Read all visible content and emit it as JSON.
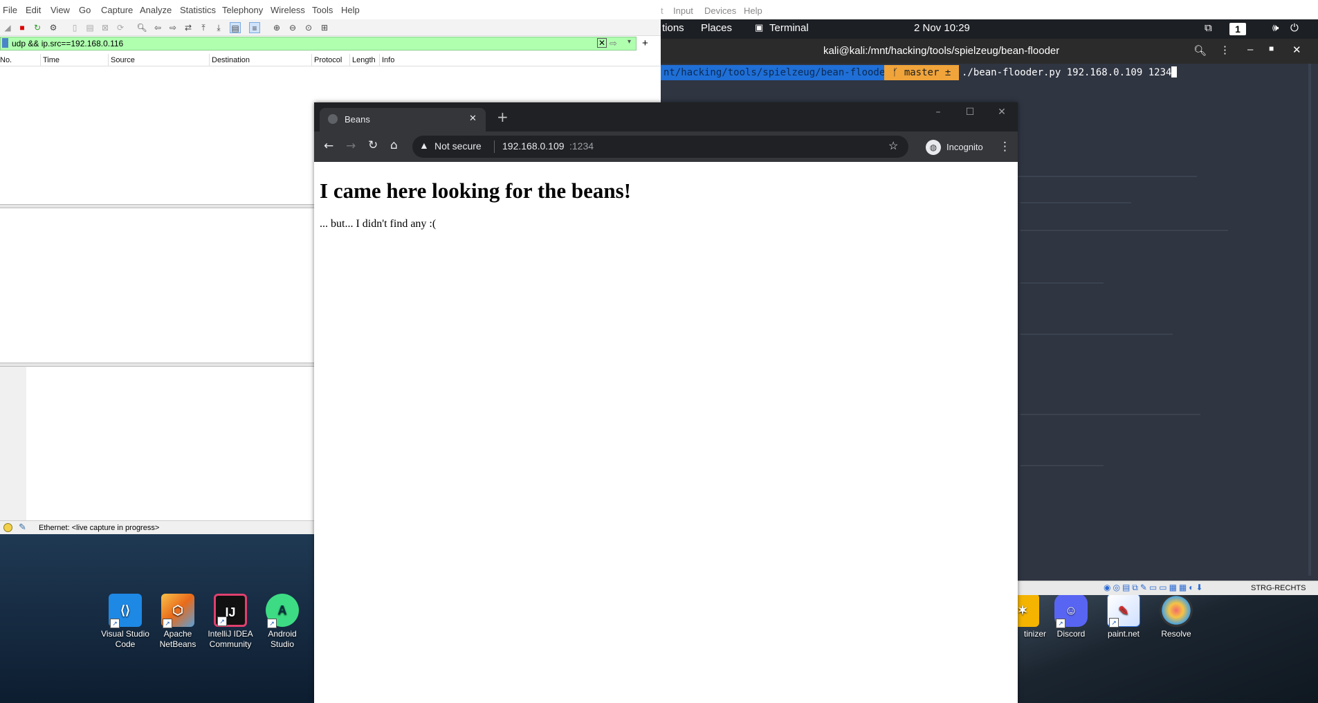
{
  "wireshark": {
    "menu": [
      "File",
      "Edit",
      "View",
      "Go",
      "Capture",
      "Analyze",
      "Statistics",
      "Telephony",
      "Wireless",
      "Tools",
      "Help"
    ],
    "filter_value": "udp && ip.src==192.168.0.116",
    "columns": [
      "No.",
      "Time",
      "Source",
      "Destination",
      "Protocol",
      "Length",
      "Info"
    ],
    "status_text": "Ethernet: <live capture in progress>",
    "filter_color": "#afffaf"
  },
  "desktop_icons": [
    {
      "label_line1": "Visual Studio",
      "label_line2": "Code",
      "icon": "vscode-icon",
      "color": "#1e88e5"
    },
    {
      "label_line1": "Apache",
      "label_line2": "NetBeans",
      "icon": "netbeans-icon",
      "color": "#ef6c00"
    },
    {
      "label_line1": "IntelliJ IDEA",
      "label_line2": "Community",
      "icon": "intellij-icon",
      "color": "#111111"
    },
    {
      "label_line1": "Android",
      "label_line2": "Studio",
      "icon": "android-studio-icon",
      "color": "#3ddc84"
    },
    {
      "label_line1": "tinizer",
      "label_line2": "",
      "icon": "app-icon",
      "color": "#f4b400"
    },
    {
      "label_line1": "Discord",
      "label_line2": "",
      "icon": "discord-icon",
      "color": "#5865f2"
    },
    {
      "label_line1": "paint.net",
      "label_line2": "",
      "icon": "paintnet-icon",
      "color": "#2a6ad4"
    },
    {
      "label_line1": "Resolve",
      "label_line2": "",
      "icon": "resolve-icon",
      "color": "#4aa3df"
    }
  ],
  "vm": {
    "menu": [
      "Input",
      "Devices",
      "Help"
    ],
    "status_key": "STRG-RECHTS"
  },
  "kali": {
    "topbar": {
      "applications_partial": "tions",
      "places": "Places",
      "terminal": "Terminal",
      "clock": "2 Nov  10:29",
      "workspace": "1"
    },
    "terminal_title": "kali@kali:/mnt/hacking/tools/spielzeug/bean-flooder",
    "prompt_path": "nt/hacking/tools/spielzeug/bean-flooder",
    "prompt_branch": "ᚶ master ±",
    "command": "./bean-flooder.py 192.168.0.109 1234"
  },
  "chrome": {
    "tab_title": "Beans",
    "new_tab": "+",
    "security_label": "Not secure",
    "url_host": "192.168.0.109",
    "url_port": ":1234",
    "profile_label": "Incognito"
  },
  "page": {
    "heading": "I came here looking for the beans!",
    "body": "... but... I didn't find any :("
  }
}
